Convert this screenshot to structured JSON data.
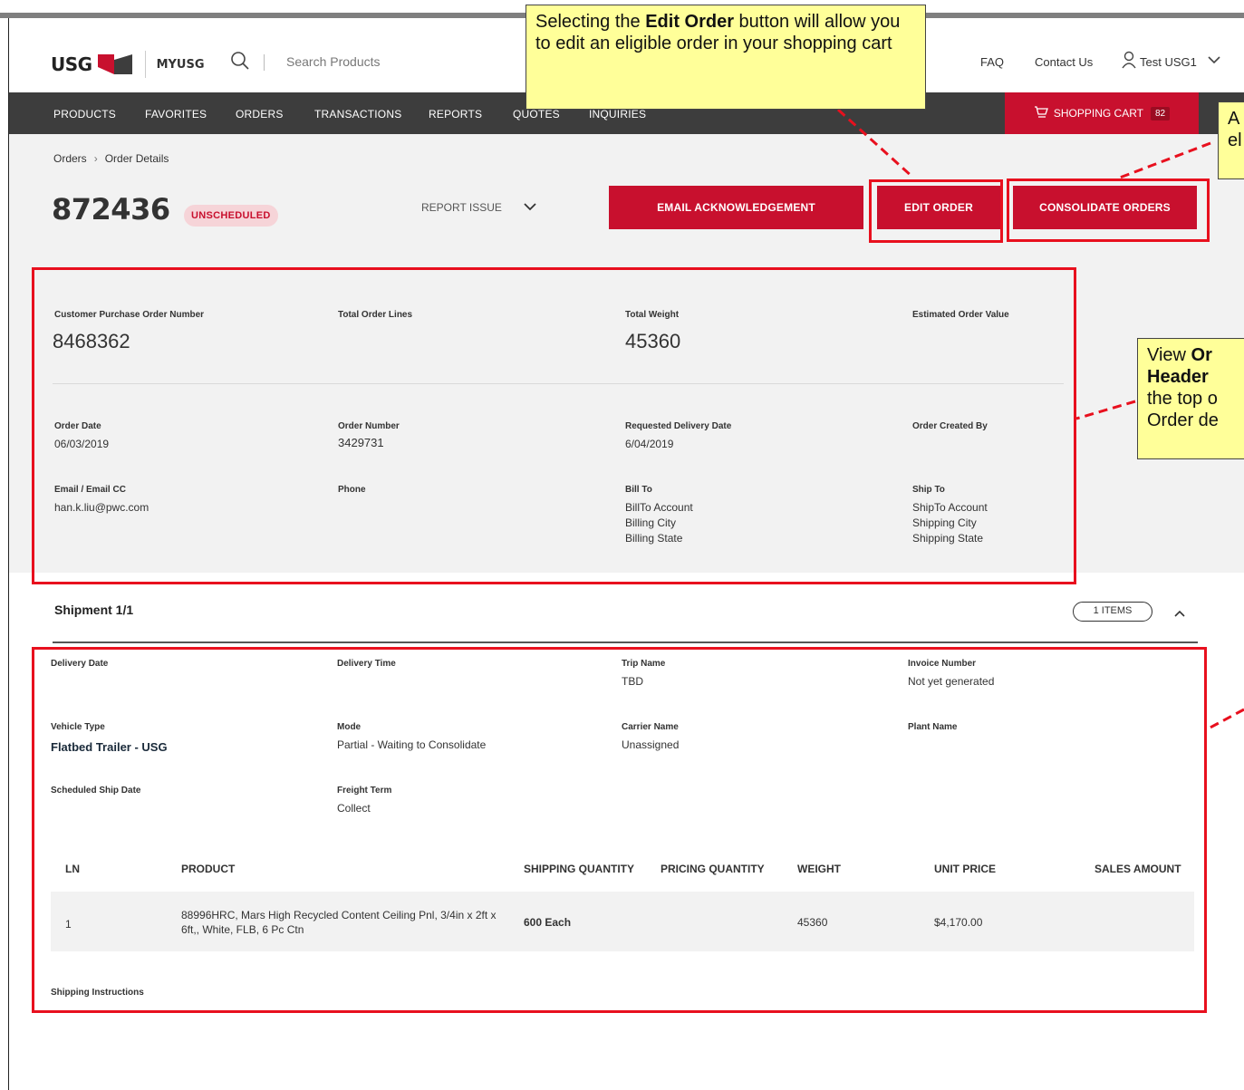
{
  "header": {
    "logo": "USG",
    "portal": "MYUSG",
    "search_placeholder": "Search Products",
    "faq": "FAQ",
    "contact": "Contact Us",
    "user": "Test USG1"
  },
  "nav": {
    "items": [
      "PRODUCTS",
      "FAVORITES",
      "ORDERS",
      "TRANSACTIONS",
      "REPORTS",
      "QUOTES",
      "INQUIRIES"
    ],
    "cart_label": "SHOPPING CART",
    "cart_count": "82"
  },
  "breadcrumb": {
    "root": "Orders",
    "sep": "›",
    "current": "Order Details"
  },
  "order": {
    "number": "872436",
    "status": "UNSCHEDULED",
    "report_issue": "REPORT ISSUE",
    "email_ack": "EMAIL ACKNOWLEDGEMENT",
    "edit_order": "EDIT ORDER",
    "consolidate": "CONSOLIDATE ORDERS"
  },
  "summary": {
    "cust_po_label": "Customer Purchase Order Number",
    "cust_po": "8468362",
    "total_lines_label": "Total Order Lines",
    "total_weight_label": "Total Weight",
    "total_weight": "45360",
    "est_value_label": "Estimated Order Value",
    "order_date_label": "Order Date",
    "order_date": "06/03/2019",
    "order_number_label": "Order Number",
    "order_number": "3429731",
    "req_delivery_label": "Requested Delivery Date",
    "req_delivery": "6/04/2019",
    "created_by_label": "Order Created By",
    "email_label": "Email / Email CC",
    "email": "han.k.liu@pwc.com",
    "phone_label": "Phone",
    "bill_to_label": "Bill To",
    "bill_to": [
      "BillTo Account",
      "Billing City",
      "Billing State"
    ],
    "ship_to_label": "Ship To",
    "ship_to": [
      "ShipTo Account",
      "Shipping City",
      "Shipping State"
    ]
  },
  "shipment": {
    "title": "Shipment 1/1",
    "items": "1 ITEMS",
    "delivery_date_label": "Delivery Date",
    "delivery_time_label": "Delivery Time",
    "trip_name_label": "Trip Name",
    "trip_name": "TBD",
    "invoice_label": "Invoice Number",
    "invoice": "Not yet generated",
    "vehicle_label": "Vehicle Type",
    "vehicle": "Flatbed Trailer - USG",
    "mode_label": "Mode",
    "mode": "Partial - Waiting to Consolidate",
    "carrier_label": "Carrier Name",
    "carrier": "Unassigned",
    "plant_label": "Plant Name",
    "sched_ship_label": "Scheduled Ship Date",
    "freight_label": "Freight Term",
    "freight": "Collect",
    "instructions_label": "Shipping Instructions"
  },
  "table": {
    "headers": [
      "LN",
      "PRODUCT",
      "SHIPPING QUANTITY",
      "PRICING QUANTITY",
      "WEIGHT",
      "UNIT PRICE",
      "SALES AMOUNT"
    ],
    "rows": [
      {
        "ln": "1",
        "product": "88996HRC, Mars High Recycled Content Ceiling Pnl, 3/4in x 2ft x 6ft,, White, FLB, 6 Pc Ctn",
        "ship_qty": "600 Each",
        "price_qty": "",
        "weight": "45360",
        "unit_price": "$4,170.00",
        "sales_amount": ""
      }
    ]
  },
  "callouts": {
    "edit_order": {
      "pre": "Selecting the ",
      "bold": "Edit Order",
      "post": " button will allow you to edit an eligible order in your shopping cart"
    },
    "consolidate": {
      "line1": "A",
      "line2": "el"
    },
    "header": {
      "pre": "View ",
      "bold1": "Or",
      "bold2": "Header",
      "line3": "the top o",
      "line4": "Order de"
    }
  },
  "colors": {
    "brand_red": "#c8102e",
    "nav_dark": "#3d3d3d",
    "highlight_red": "#e8101e",
    "callout_yellow": "#ffff99"
  }
}
